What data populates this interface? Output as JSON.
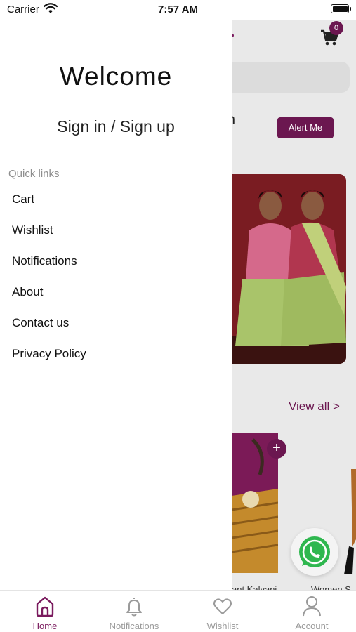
{
  "status_bar": {
    "carrier": "Carrier",
    "time": "7:57 AM"
  },
  "background": {
    "cart_count": "0",
    "promo_line_1": "oon",
    "promo_line_2": "tart",
    "alert_button": "Alert Me",
    "view_all": "View all >",
    "add_symbol": "+",
    "product_1_name": "ant Kalyani",
    "product_2_name": "Women S"
  },
  "drawer": {
    "welcome": "Welcome",
    "signin": "Sign in / Sign up",
    "quick_links_label": "Quick links",
    "menu": [
      {
        "label": "Cart"
      },
      {
        "label": "Wishlist"
      },
      {
        "label": "Notifications"
      },
      {
        "label": "About"
      },
      {
        "label": "Contact us"
      },
      {
        "label": "Privacy Policy"
      }
    ]
  },
  "tab_bar": {
    "tabs": [
      {
        "label": "Home",
        "icon": "home-icon",
        "active": true
      },
      {
        "label": "Notifications",
        "icon": "bell-icon",
        "active": false
      },
      {
        "label": "Wishlist",
        "icon": "heart-icon",
        "active": false
      },
      {
        "label": "Account",
        "icon": "user-icon",
        "active": false
      }
    ]
  },
  "colors": {
    "accent": "#7a1a5e",
    "inactive": "#9a9a9a",
    "whatsapp": "#25d366"
  }
}
